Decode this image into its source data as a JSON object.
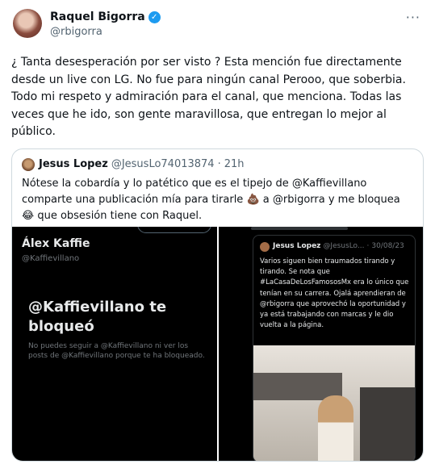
{
  "tweet": {
    "display_name": "Raquel Bigorra",
    "verified_icon": "✓",
    "handle": "@rbigorra",
    "more_icon": "···",
    "text": "¿ Tanta desesperación por ser visto ? Esta mención fue directamente desde un live con LG. No fue para ningún canal Perooo, que soberbia. Todo mi respeto y admiración para el canal, que menciona. Todas las veces que he ido, son gente maravillosa, que entregan lo mejor al público."
  },
  "quote": {
    "display_name": "Jesus Lopez",
    "handle": "@JesusLo74013874",
    "separator": "·",
    "time": "21h",
    "text": "Nótese la cobardía y lo patético que es el tipejo de @Kaffievillano comparte una publicación mía para tirarle 💩 a @rbigorra y me bloquea 😂 que obsesión tiene con Raquel."
  },
  "media_left": {
    "name": "Álex Kaffie",
    "handle": "@Kaffievillano",
    "blocked_title": "@Kaffievillano te bloqueó",
    "blocked_desc": "No puedes seguir a @Kaffievillano ni ver los posts de @Kaffievillano porque te ha bloqueado."
  },
  "media_right": {
    "name": "Jesus Lopez",
    "handle": "@JesusLo...",
    "separator": "·",
    "date": "30/08/23",
    "text": "Varios siguen bien traumados tirando y tirando. Se nota que #LaCasaDeLosFamososMx era lo único que tenían en su carrera. Ojalá aprendieran de @rbigorra que aprovechó la oportunidad y ya está trabajando con marcas y le dio vuelta a la página."
  }
}
